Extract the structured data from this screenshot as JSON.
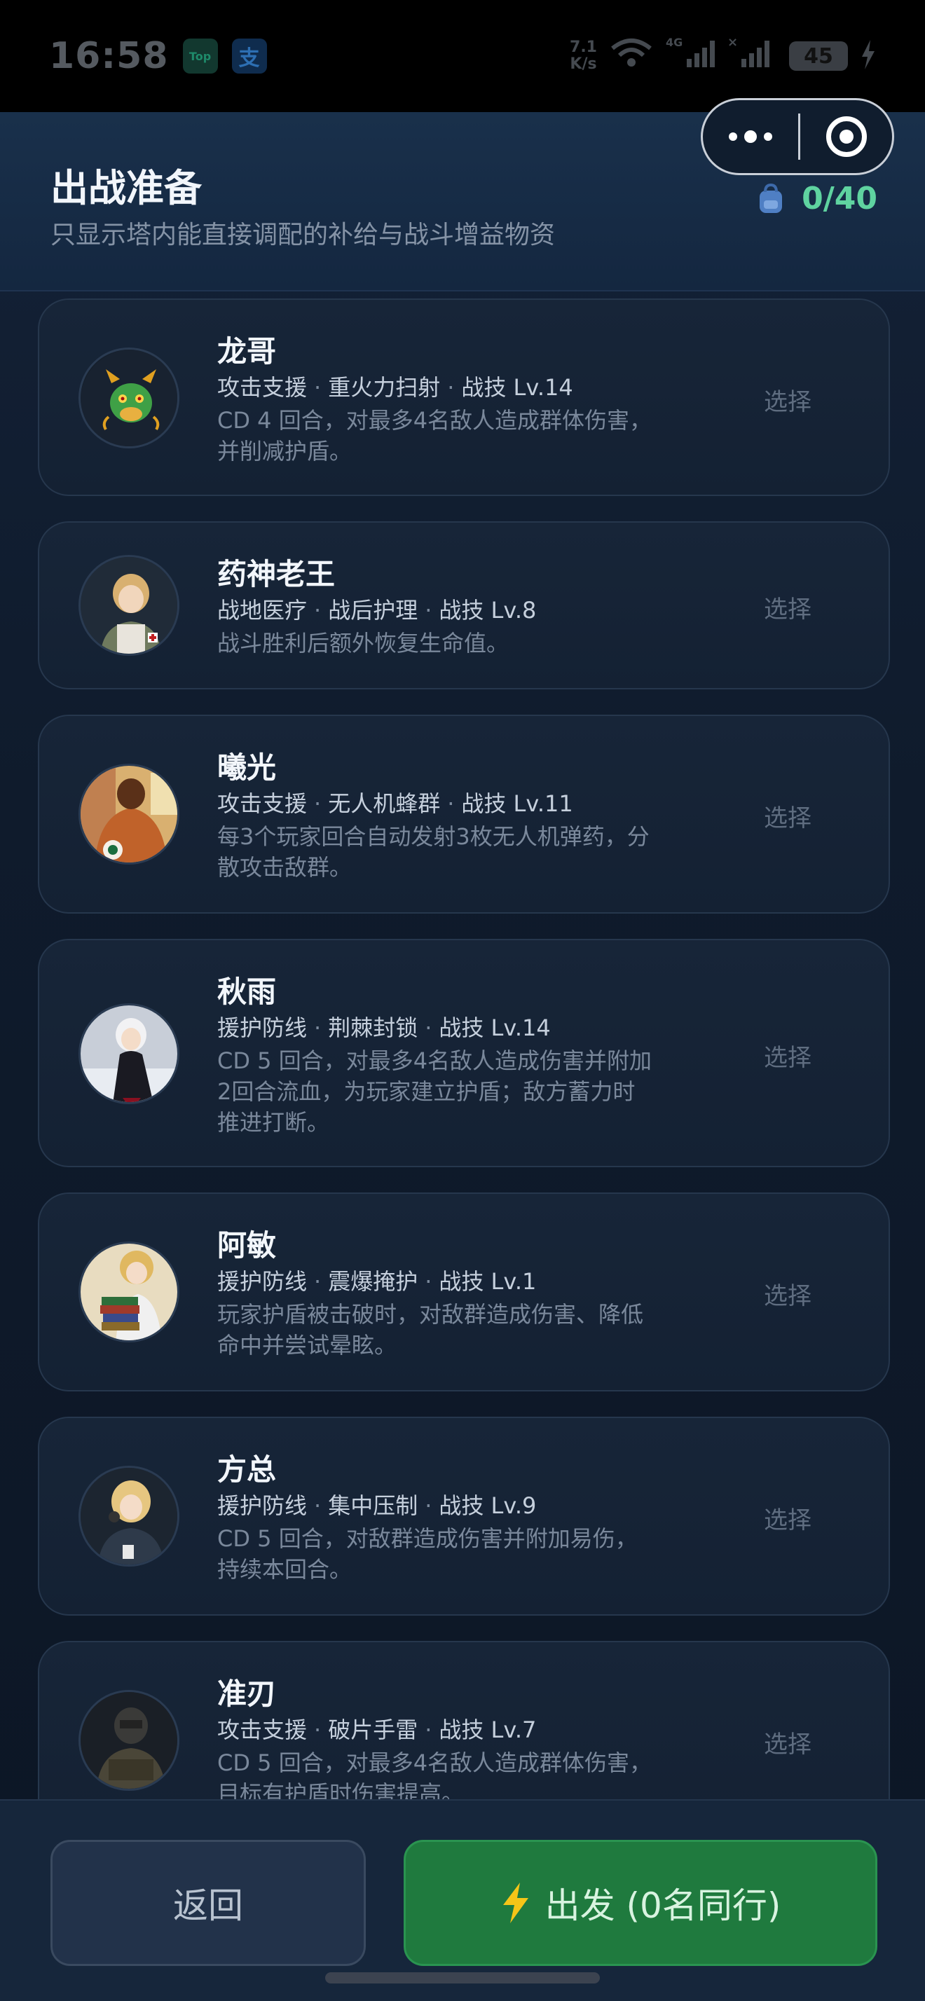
{
  "status_bar": {
    "time": "16:58",
    "app_badges": [
      "Top",
      "支"
    ],
    "net_speed": "7.1\nK/s",
    "network": "4G",
    "battery": "45"
  },
  "header": {
    "title": "出战准备",
    "subtitle": "只显示塔内能直接调配的补给与战斗增益物资",
    "bag_counter": "0/40",
    "bag_icon": "backpack-icon"
  },
  "capsule": {
    "more_icon": "more-dots-icon",
    "close_icon": "target-close-icon"
  },
  "cards": [
    {
      "name": "龙哥",
      "category": "攻击支援",
      "skill": "重火力扫射",
      "level": "战技 Lv.14",
      "desc_lines": [
        "CD 4 回合，对最多4名敌人造成群体伤害，",
        "并削减护盾。"
      ],
      "select": "选择",
      "avatar": "dragon-avatar"
    },
    {
      "name": "药神老王",
      "category": "战地医疗",
      "skill": "战后护理",
      "level": "战技 Lv.8",
      "desc_lines": [
        "战斗胜利后额外恢复生命值。"
      ],
      "select": "选择",
      "avatar": "medic-avatar"
    },
    {
      "name": "曦光",
      "category": "攻击支援",
      "skill": "无人机蜂群",
      "level": "战技 Lv.11",
      "desc_lines": [
        "每3个玩家回合自动发射3枚无人机弹药，分",
        "散攻击敌群。"
      ],
      "select": "选择",
      "avatar": "orange-jacket-avatar"
    },
    {
      "name": "秋雨",
      "category": "援护防线",
      "skill": "荆棘封锁",
      "level": "战技 Lv.14",
      "desc_lines": [
        "CD 5 回合，对最多4名敌人造成伤害并附加",
        "2回合流血，为玩家建立护盾；敌方蓄力时",
        "推进打断。"
      ],
      "select": "选择",
      "avatar": "white-hair-avatar"
    },
    {
      "name": "阿敏",
      "category": "援护防线",
      "skill": "震爆掩护",
      "level": "战技 Lv.1",
      "desc_lines": [
        "玩家护盾被击破时，对敌群造成伤害、降低",
        "命中并尝试晕眩。"
      ],
      "select": "选择",
      "avatar": "books-avatar"
    },
    {
      "name": "方总",
      "category": "援护防线",
      "skill": "集中压制",
      "level": "战技 Lv.9",
      "desc_lines": [
        "CD 5 回合，对敌群造成伤害并附加易伤，",
        "持续本回合。"
      ],
      "select": "选择",
      "avatar": "officer-avatar"
    },
    {
      "name": "准刃",
      "category": "攻击支援",
      "skill": "破片手雷",
      "level": "战技 Lv.7",
      "desc_lines": [
        "CD 5 回合，对最多4名敌人造成群体伤害，",
        "目标有护盾时伤害提高。"
      ],
      "select": "选择",
      "avatar": "soldier-avatar"
    }
  ],
  "bottom": {
    "back_label": "返回",
    "go_label": "出发 (0名同行)",
    "go_icon": "lightning-icon"
  },
  "colors": {
    "accent_green": "#5fd3a0",
    "go_button": "#1f7a3e",
    "background": "#0f1a2a"
  }
}
